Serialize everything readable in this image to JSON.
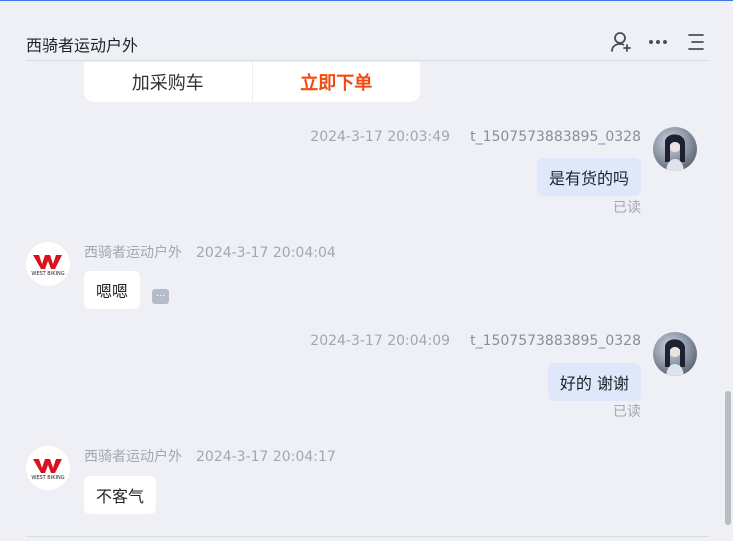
{
  "header": {
    "shop_name": "西骑者运动户外",
    "icons": [
      "add-contact-icon",
      "more-dots-icon",
      "menu-icon"
    ]
  },
  "card": {
    "buy_more": "加采购车",
    "order_now": "立即下单",
    "order_color": "#f04b10"
  },
  "messages": [
    {
      "sender": "t_1507573883895_0328",
      "time": "2024-3-17 20:03:49",
      "text": "是有货的吗",
      "status": "已读"
    },
    {
      "sender": "西骑者运动户外",
      "time": "2024-3-17 20:04:04",
      "text": "嗯嗯",
      "logo_text": "WEST BIKING"
    },
    {
      "sender": "t_1507573883895_0328",
      "time": "2024-3-17 20:04:09",
      "text": "好的 谢谢",
      "status": "已读"
    },
    {
      "sender": "西骑者运动户外",
      "time": "2024-3-17 20:04:17",
      "text": "不客气",
      "logo_text": "WEST BIKING"
    }
  ],
  "colors": {
    "accent": "#3f78e6",
    "bubble_me": "#dfe7fb",
    "background": "#eef0f5"
  }
}
